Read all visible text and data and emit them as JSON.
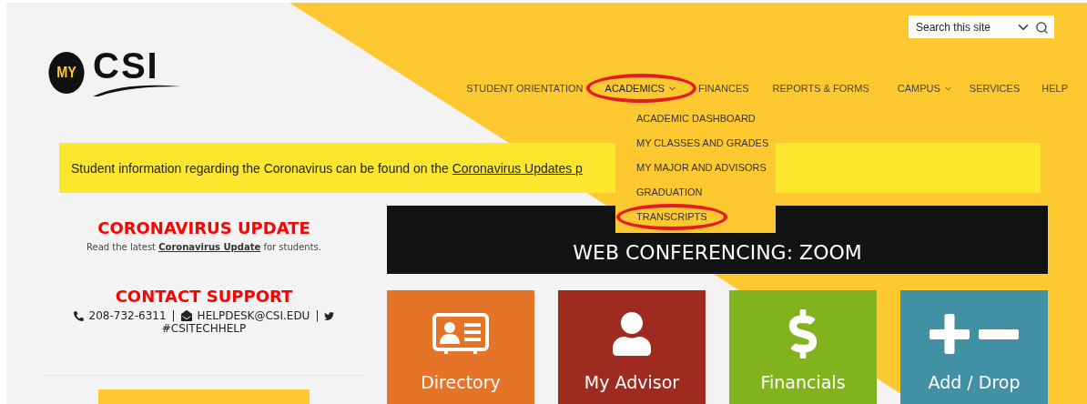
{
  "logo": {
    "badge": "MY",
    "name": "CSI"
  },
  "search": {
    "placeholder": "Search this site"
  },
  "nav": [
    {
      "label": "STUDENT ORIENTATION",
      "has_menu": false,
      "expanded": false,
      "circled": false
    },
    {
      "label": "ACADEMICS",
      "has_menu": true,
      "expanded": true,
      "circled": true
    },
    {
      "label": "FINANCES",
      "has_menu": false,
      "expanded": false,
      "circled": false
    },
    {
      "label": "REPORTS & FORMS",
      "has_menu": false,
      "expanded": false,
      "circled": false
    },
    {
      "label": "CAMPUS",
      "has_menu": true,
      "expanded": false,
      "circled": false
    },
    {
      "label": "SERVICES",
      "has_menu": false,
      "expanded": false,
      "circled": false
    },
    {
      "label": "HELP",
      "has_menu": false,
      "expanded": false,
      "circled": false
    }
  ],
  "dropdown": [
    {
      "label": "ACADEMIC DASHBOARD",
      "circled": false
    },
    {
      "label": "MY CLASSES AND GRADES",
      "circled": false
    },
    {
      "label": "MY MAJOR AND ADVISORS",
      "circled": false
    },
    {
      "label": "GRADUATION",
      "circled": false
    },
    {
      "label": "TRANSCRIPTS",
      "circled": true
    }
  ],
  "banner": {
    "text": "Student information regarding the Coronavirus can be found on the ",
    "link": "Coronavirus Updates p"
  },
  "coronavirus": {
    "title": "CORONAVIRUS UPDATE",
    "before": "Read the latest ",
    "link": "Coronavirus Update",
    "after": " for students."
  },
  "support": {
    "title": "CONTACT SUPPORT",
    "phone": "208-732-6311",
    "sep1": "|",
    "email": "HELPDESK@CSI.EDU",
    "sep2": "|",
    "twitter": "#CSITECHHELP"
  },
  "feature": {
    "title": "WEB CONFERENCING: ZOOM"
  },
  "tiles": [
    {
      "kind": "directory",
      "label": "Directory",
      "color": "#e57428"
    },
    {
      "kind": "advisor",
      "label": "My Advisor",
      "color": "#9e2a20"
    },
    {
      "kind": "financials",
      "label": "Financials",
      "color": "#82b31f"
    },
    {
      "kind": "add-drop",
      "label": "Add / Drop",
      "color": "#4290a4"
    }
  ]
}
